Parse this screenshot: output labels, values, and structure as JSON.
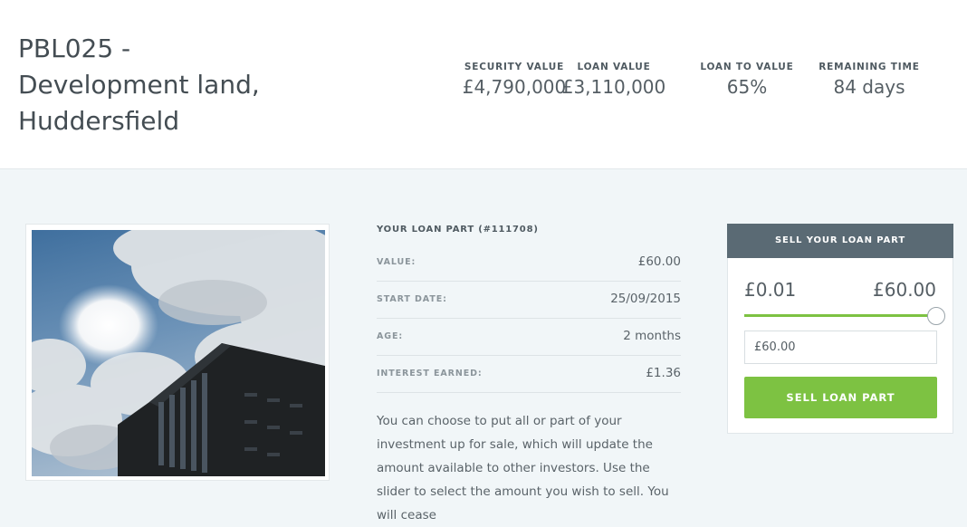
{
  "listing": {
    "title_lines": [
      "PBL025 -",
      "Development land,",
      "Huddersfield"
    ]
  },
  "stats": [
    {
      "label": "SECURITY VALUE",
      "value": "£4,790,000"
    },
    {
      "label": "LOAN VALUE",
      "value": "£3,110,000"
    },
    {
      "label": "LOAN TO VALUE",
      "value": "65%"
    },
    {
      "label": "REMAINING TIME",
      "value": "84 days"
    }
  ],
  "loan_part": {
    "heading": "YOUR LOAN PART (#111708)",
    "rows": [
      {
        "label": "VALUE:",
        "value": "£60.00"
      },
      {
        "label": "START DATE:",
        "value": "25/09/2015"
      },
      {
        "label": "AGE:",
        "value": "2 months"
      },
      {
        "label": "INTEREST EARNED:",
        "value": "£1.36"
      }
    ],
    "description": "You can choose to put all or part of your investment up for sale, which will update the amount available to other investors. Use the slider to select the amount you wish to sell. You will cease"
  },
  "sell_panel": {
    "heading": "SELL YOUR LOAN PART",
    "range_min": "£0.01",
    "range_max": "£60.00",
    "slider_fraction": 1.0,
    "amount_value": "£60.00",
    "button_label": "SELL LOAN PART"
  },
  "colors": {
    "accent_green": "#7dc242",
    "panel_header": "#5a6a74",
    "page_background": "#f1f6f8"
  }
}
